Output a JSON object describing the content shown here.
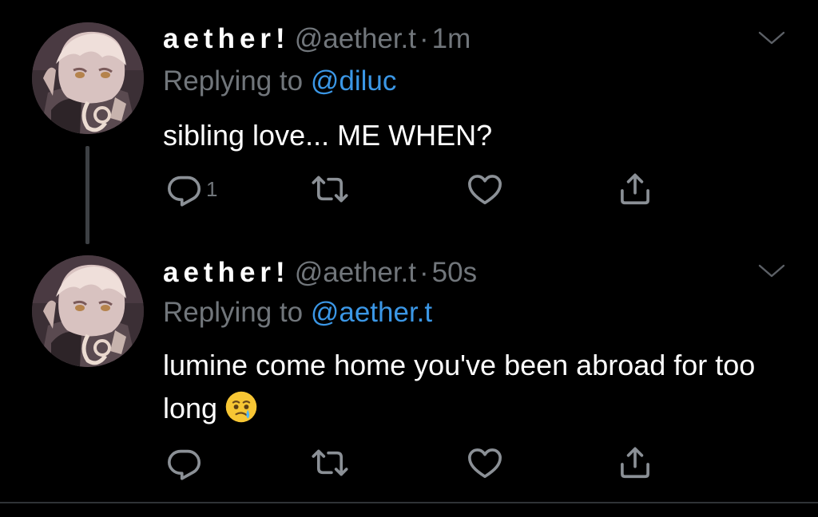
{
  "tweets": [
    {
      "display_name": "aether!",
      "handle": "@aether.t",
      "separator": "·",
      "time": "1m",
      "replying_prefix": "Replying to",
      "replying_to": "@diluc",
      "text": "sibling love... ME WHEN?",
      "reply_count": "1"
    },
    {
      "display_name": "aether!",
      "handle": "@aether.t",
      "separator": "·",
      "time": "50s",
      "replying_prefix": "Replying to",
      "replying_to": "@aether.t",
      "text": "lumine come home you've been abroad for too long",
      "emoji": "face-holding-back-tears",
      "reply_count": ""
    }
  ],
  "icons": {
    "reply": "reply-icon",
    "retweet": "retweet-icon",
    "like": "heart-icon",
    "share": "share-icon",
    "more": "chevron-down-icon"
  },
  "colors": {
    "background": "#000000",
    "text": "#ffffff",
    "secondary": "#71767b",
    "link": "#3b97e6",
    "icon": "#8b9096",
    "thread_line": "#3d4044",
    "divider": "#2f3336"
  }
}
